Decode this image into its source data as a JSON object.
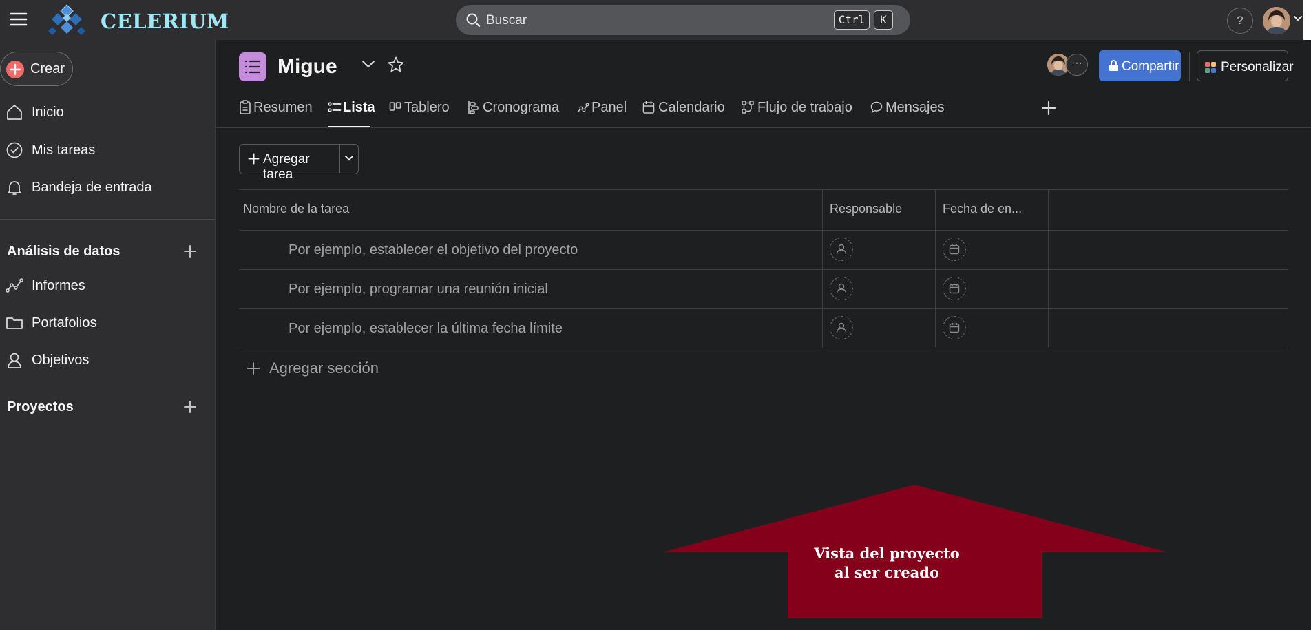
{
  "topbar": {
    "brand": "CELERIUM",
    "search_placeholder": "Buscar",
    "shortcut_ctrl": "Ctrl",
    "shortcut_key": "K",
    "help": "?"
  },
  "sidebar": {
    "create_label": "Crear",
    "nav": [
      {
        "label": "Inicio",
        "icon": "home-icon"
      },
      {
        "label": "Mis tareas",
        "icon": "check-circle-icon"
      },
      {
        "label": "Bandeja de entrada",
        "icon": "bell-icon"
      }
    ],
    "analytics_title": "Análisis de datos",
    "analytics_items": [
      {
        "label": "Informes",
        "icon": "line-chart-icon"
      },
      {
        "label": "Portafolios",
        "icon": "folder-icon"
      },
      {
        "label": "Objetivos",
        "icon": "person-icon"
      }
    ],
    "projects_title": "Proyectos"
  },
  "project": {
    "title": "Migue",
    "more_label": "···",
    "share_label": "Compartir",
    "customize_label": "Personalizar"
  },
  "tabs": [
    {
      "label": "Resumen",
      "icon": "clipboard-icon",
      "active": false
    },
    {
      "label": "Lista",
      "icon": "list-icon",
      "active": true
    },
    {
      "label": "Tablero",
      "icon": "board-icon",
      "active": false
    },
    {
      "label": "Cronograma",
      "icon": "timeline-icon",
      "active": false
    },
    {
      "label": "Panel",
      "icon": "dashboard-icon",
      "active": false
    },
    {
      "label": "Calendario",
      "icon": "calendar-icon",
      "active": false
    },
    {
      "label": "Flujo de trabajo",
      "icon": "workflow-icon",
      "active": false
    },
    {
      "label": "Mensajes",
      "icon": "message-icon",
      "active": false
    }
  ],
  "toolbar": {
    "add_task_label": "Agregar tarea"
  },
  "table": {
    "columns": [
      "Nombre de la tarea",
      "Responsable",
      "Fecha de en..."
    ],
    "rows": [
      {
        "name": "Por ejemplo, establecer el objetivo del proyecto"
      },
      {
        "name": "Por ejemplo, programar una reunión inicial"
      },
      {
        "name": "Por ejemplo, establecer la última fecha límite"
      }
    ],
    "add_section_label": "Agregar sección"
  },
  "annotation": {
    "line1": "Vista del proyecto",
    "line2": "al ser creado",
    "color": "#85001a"
  },
  "colors": {
    "background": "#1e1f21",
    "sidebar": "#2e2e30",
    "accent_blue": "#4573d2",
    "project_icon": "#c58cdc",
    "create_plus": "#f06a6a",
    "brand_text": "#9fe7f5"
  }
}
